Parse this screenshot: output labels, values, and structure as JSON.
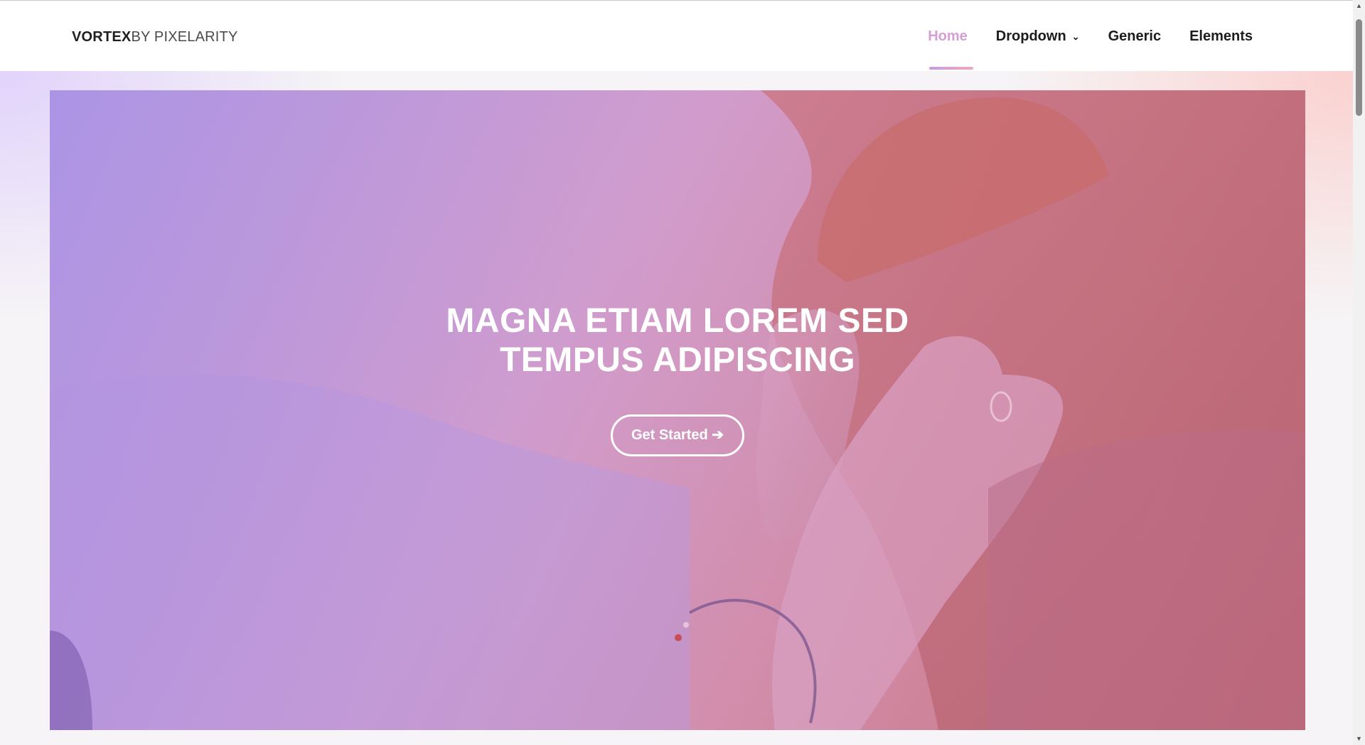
{
  "header": {
    "logo_strong": "VORTEX",
    "logo_rest": "BY PIXELARITY",
    "nav": [
      {
        "label": "Home",
        "active": true
      },
      {
        "label": "Dropdown",
        "has_dropdown": true
      },
      {
        "label": "Generic"
      },
      {
        "label": "Elements"
      }
    ],
    "dropdown_icon": "chevron-down-icon"
  },
  "hero": {
    "title": "MAGNA ETIAM LOREM SED TEMPUS ADIPISCING",
    "button_label": "Get Started ➔",
    "image": "woman-with-hand-on-face-photo"
  },
  "colors": {
    "accent": "#d59fd6",
    "underline_start": "#c79ae6",
    "underline_end": "#f4a8b6",
    "text_dark": "#1c1c1c"
  }
}
